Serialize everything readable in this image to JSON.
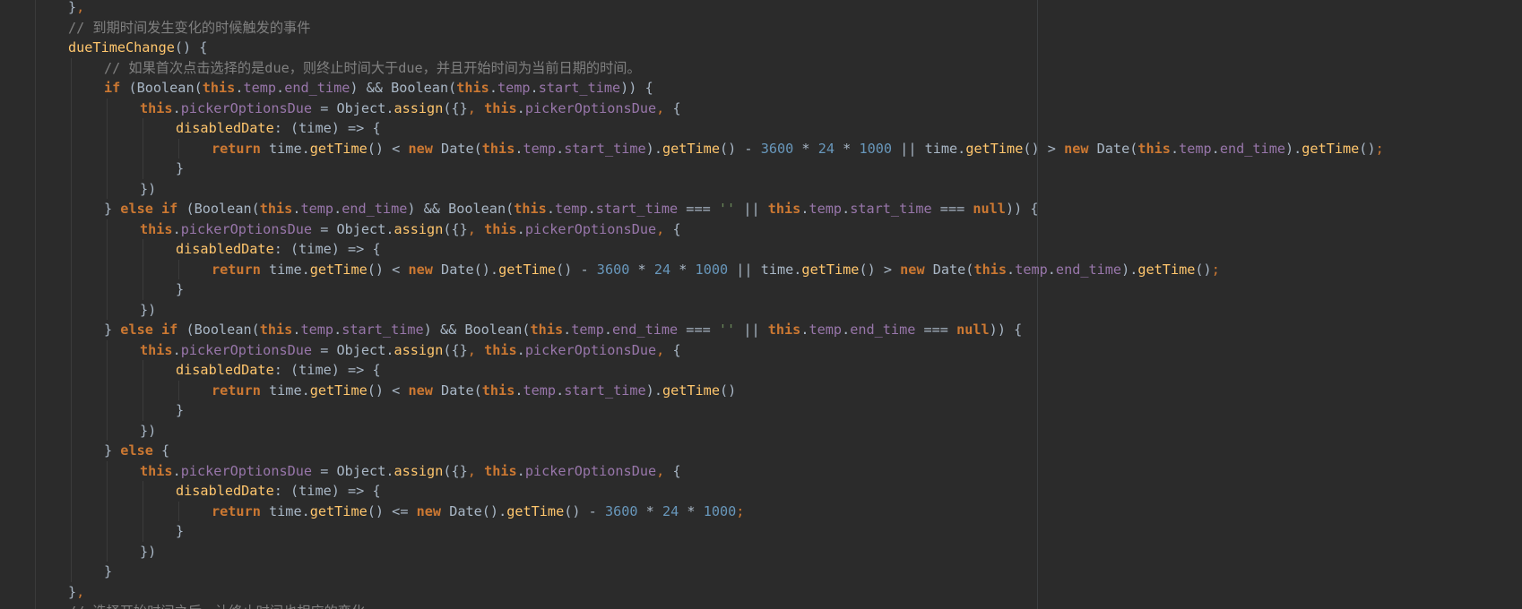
{
  "colors": {
    "background": "#2b2b2b",
    "text": "#a9b7c6",
    "keyword": "#cc7832",
    "field": "#9876aa",
    "method": "#ffc66d",
    "number": "#6897bb",
    "string": "#6a8759",
    "comment": "#808080"
  },
  "code_lines": [
    {
      "indent": 1,
      "tokens": [
        [
          "plain",
          "}"
        ],
        [
          "punct",
          ","
        ]
      ]
    },
    {
      "indent": 1,
      "tokens": [
        [
          "comment",
          "// 到期时间发生变化的时候触发的事件"
        ]
      ]
    },
    {
      "indent": 1,
      "tokens": [
        [
          "method",
          "dueTimeChange"
        ],
        [
          "plain",
          "() {"
        ]
      ]
    },
    {
      "indent": 2,
      "tokens": [
        [
          "comment",
          "// 如果首次点击选择的是due，则终止时间大于due，并且开始时间为当前日期的时间。"
        ]
      ]
    },
    {
      "indent": 2,
      "tokens": [
        [
          "keyword",
          "if"
        ],
        [
          "plain",
          " (Boolean("
        ],
        [
          "keyword",
          "this"
        ],
        [
          "plain",
          "."
        ],
        [
          "field",
          "temp"
        ],
        [
          "plain",
          "."
        ],
        [
          "field",
          "end_time"
        ],
        [
          "plain",
          ") && Boolean("
        ],
        [
          "keyword",
          "this"
        ],
        [
          "plain",
          "."
        ],
        [
          "field",
          "temp"
        ],
        [
          "plain",
          "."
        ],
        [
          "field",
          "start_time"
        ],
        [
          "plain",
          ")) {"
        ]
      ]
    },
    {
      "indent": 3,
      "tokens": [
        [
          "keyword",
          "this"
        ],
        [
          "plain",
          "."
        ],
        [
          "field",
          "pickerOptionsDue"
        ],
        [
          "plain",
          " = Object."
        ],
        [
          "method",
          "assign"
        ],
        [
          "plain",
          "({}"
        ],
        [
          "punct",
          ", "
        ],
        [
          "keyword",
          "this"
        ],
        [
          "plain",
          "."
        ],
        [
          "field",
          "pickerOptionsDue"
        ],
        [
          "punct",
          ", "
        ],
        [
          "plain",
          "{"
        ]
      ]
    },
    {
      "indent": 4,
      "tokens": [
        [
          "method",
          "disabledDate"
        ],
        [
          "plain",
          ": (time) => {"
        ]
      ]
    },
    {
      "indent": 5,
      "tokens": [
        [
          "keyword",
          "return "
        ],
        [
          "plain",
          "time."
        ],
        [
          "method",
          "getTime"
        ],
        [
          "plain",
          "() < "
        ],
        [
          "keyword",
          "new "
        ],
        [
          "plain",
          "Date("
        ],
        [
          "keyword",
          "this"
        ],
        [
          "plain",
          "."
        ],
        [
          "field",
          "temp"
        ],
        [
          "plain",
          "."
        ],
        [
          "field",
          "start_time"
        ],
        [
          "plain",
          ")."
        ],
        [
          "method",
          "getTime"
        ],
        [
          "plain",
          "() - "
        ],
        [
          "number",
          "3600"
        ],
        [
          "plain",
          " * "
        ],
        [
          "number",
          "24"
        ],
        [
          "plain",
          " * "
        ],
        [
          "number",
          "1000"
        ],
        [
          "plain",
          " || time."
        ],
        [
          "method",
          "getTime"
        ],
        [
          "plain",
          "() > "
        ],
        [
          "keyword",
          "new "
        ],
        [
          "plain",
          "Date("
        ],
        [
          "keyword",
          "this"
        ],
        [
          "plain",
          "."
        ],
        [
          "field",
          "temp"
        ],
        [
          "plain",
          "."
        ],
        [
          "field",
          "end_time"
        ],
        [
          "plain",
          ")."
        ],
        [
          "method",
          "getTime"
        ],
        [
          "plain",
          "()"
        ],
        [
          "punct",
          ";"
        ]
      ]
    },
    {
      "indent": 4,
      "tokens": [
        [
          "plain",
          "}"
        ]
      ]
    },
    {
      "indent": 3,
      "tokens": [
        [
          "plain",
          "})"
        ]
      ]
    },
    {
      "indent": 2,
      "tokens": [
        [
          "plain",
          "} "
        ],
        [
          "keyword",
          "else if"
        ],
        [
          "plain",
          " (Boolean("
        ],
        [
          "keyword",
          "this"
        ],
        [
          "plain",
          "."
        ],
        [
          "field",
          "temp"
        ],
        [
          "plain",
          "."
        ],
        [
          "field",
          "end_time"
        ],
        [
          "plain",
          ") && Boolean("
        ],
        [
          "keyword",
          "this"
        ],
        [
          "plain",
          "."
        ],
        [
          "field",
          "temp"
        ],
        [
          "plain",
          "."
        ],
        [
          "field",
          "start_time"
        ],
        [
          "plain",
          " === "
        ],
        [
          "string",
          "''"
        ],
        [
          "plain",
          " || "
        ],
        [
          "keyword",
          "this"
        ],
        [
          "plain",
          "."
        ],
        [
          "field",
          "temp"
        ],
        [
          "plain",
          "."
        ],
        [
          "field",
          "start_time"
        ],
        [
          "plain",
          " === "
        ],
        [
          "keyword",
          "null"
        ],
        [
          "plain",
          ")) {"
        ]
      ]
    },
    {
      "indent": 3,
      "tokens": [
        [
          "keyword",
          "this"
        ],
        [
          "plain",
          "."
        ],
        [
          "field",
          "pickerOptionsDue"
        ],
        [
          "plain",
          " = Object."
        ],
        [
          "method",
          "assign"
        ],
        [
          "plain",
          "({}"
        ],
        [
          "punct",
          ", "
        ],
        [
          "keyword",
          "this"
        ],
        [
          "plain",
          "."
        ],
        [
          "field",
          "pickerOptionsDue"
        ],
        [
          "punct",
          ", "
        ],
        [
          "plain",
          "{"
        ]
      ]
    },
    {
      "indent": 4,
      "tokens": [
        [
          "method",
          "disabledDate"
        ],
        [
          "plain",
          ": (time) => {"
        ]
      ]
    },
    {
      "indent": 5,
      "tokens": [
        [
          "keyword",
          "return "
        ],
        [
          "plain",
          "time."
        ],
        [
          "method",
          "getTime"
        ],
        [
          "plain",
          "() < "
        ],
        [
          "keyword",
          "new "
        ],
        [
          "plain",
          "Date()."
        ],
        [
          "method",
          "getTime"
        ],
        [
          "plain",
          "() - "
        ],
        [
          "number",
          "3600"
        ],
        [
          "plain",
          " * "
        ],
        [
          "number",
          "24"
        ],
        [
          "plain",
          " * "
        ],
        [
          "number",
          "1000"
        ],
        [
          "plain",
          " || time."
        ],
        [
          "method",
          "getTime"
        ],
        [
          "plain",
          "() > "
        ],
        [
          "keyword",
          "new "
        ],
        [
          "plain",
          "Date("
        ],
        [
          "keyword",
          "this"
        ],
        [
          "plain",
          "."
        ],
        [
          "field",
          "temp"
        ],
        [
          "plain",
          "."
        ],
        [
          "field",
          "end_time"
        ],
        [
          "plain",
          ")."
        ],
        [
          "method",
          "getTime"
        ],
        [
          "plain",
          "()"
        ],
        [
          "punct",
          ";"
        ]
      ]
    },
    {
      "indent": 4,
      "tokens": [
        [
          "plain",
          "}"
        ]
      ]
    },
    {
      "indent": 3,
      "tokens": [
        [
          "plain",
          "})"
        ]
      ]
    },
    {
      "indent": 2,
      "tokens": [
        [
          "plain",
          "} "
        ],
        [
          "keyword",
          "else if"
        ],
        [
          "plain",
          " (Boolean("
        ],
        [
          "keyword",
          "this"
        ],
        [
          "plain",
          "."
        ],
        [
          "field",
          "temp"
        ],
        [
          "plain",
          "."
        ],
        [
          "field",
          "start_time"
        ],
        [
          "plain",
          ") && Boolean("
        ],
        [
          "keyword",
          "this"
        ],
        [
          "plain",
          "."
        ],
        [
          "field",
          "temp"
        ],
        [
          "plain",
          "."
        ],
        [
          "field",
          "end_time"
        ],
        [
          "plain",
          " === "
        ],
        [
          "string",
          "''"
        ],
        [
          "plain",
          " || "
        ],
        [
          "keyword",
          "this"
        ],
        [
          "plain",
          "."
        ],
        [
          "field",
          "temp"
        ],
        [
          "plain",
          "."
        ],
        [
          "field",
          "end_time"
        ],
        [
          "plain",
          " === "
        ],
        [
          "keyword",
          "null"
        ],
        [
          "plain",
          ")) {"
        ]
      ]
    },
    {
      "indent": 3,
      "tokens": [
        [
          "keyword",
          "this"
        ],
        [
          "plain",
          "."
        ],
        [
          "field",
          "pickerOptionsDue"
        ],
        [
          "plain",
          " = Object."
        ],
        [
          "method",
          "assign"
        ],
        [
          "plain",
          "({}"
        ],
        [
          "punct",
          ", "
        ],
        [
          "keyword",
          "this"
        ],
        [
          "plain",
          "."
        ],
        [
          "field",
          "pickerOptionsDue"
        ],
        [
          "punct",
          ", "
        ],
        [
          "plain",
          "{"
        ]
      ]
    },
    {
      "indent": 4,
      "tokens": [
        [
          "method",
          "disabledDate"
        ],
        [
          "plain",
          ": (time) => {"
        ]
      ]
    },
    {
      "indent": 5,
      "tokens": [
        [
          "keyword",
          "return "
        ],
        [
          "plain",
          "time."
        ],
        [
          "method",
          "getTime"
        ],
        [
          "plain",
          "() < "
        ],
        [
          "keyword",
          "new "
        ],
        [
          "plain",
          "Date("
        ],
        [
          "keyword",
          "this"
        ],
        [
          "plain",
          "."
        ],
        [
          "field",
          "temp"
        ],
        [
          "plain",
          "."
        ],
        [
          "field",
          "start_time"
        ],
        [
          "plain",
          ")."
        ],
        [
          "method",
          "getTime"
        ],
        [
          "plain",
          "()"
        ]
      ]
    },
    {
      "indent": 4,
      "tokens": [
        [
          "plain",
          "}"
        ]
      ]
    },
    {
      "indent": 3,
      "tokens": [
        [
          "plain",
          "})"
        ]
      ]
    },
    {
      "indent": 2,
      "tokens": [
        [
          "plain",
          "} "
        ],
        [
          "keyword",
          "else"
        ],
        [
          "plain",
          " {"
        ]
      ]
    },
    {
      "indent": 3,
      "tokens": [
        [
          "keyword",
          "this"
        ],
        [
          "plain",
          "."
        ],
        [
          "field",
          "pickerOptionsDue"
        ],
        [
          "plain",
          " = Object."
        ],
        [
          "method",
          "assign"
        ],
        [
          "plain",
          "({}"
        ],
        [
          "punct",
          ", "
        ],
        [
          "keyword",
          "this"
        ],
        [
          "plain",
          "."
        ],
        [
          "field",
          "pickerOptionsDue"
        ],
        [
          "punct",
          ", "
        ],
        [
          "plain",
          "{"
        ]
      ]
    },
    {
      "indent": 4,
      "tokens": [
        [
          "method",
          "disabledDate"
        ],
        [
          "plain",
          ": (time) => {"
        ]
      ]
    },
    {
      "indent": 5,
      "tokens": [
        [
          "keyword",
          "return "
        ],
        [
          "plain",
          "time."
        ],
        [
          "method",
          "getTime"
        ],
        [
          "plain",
          "() <= "
        ],
        [
          "keyword",
          "new "
        ],
        [
          "plain",
          "Date()."
        ],
        [
          "method",
          "getTime"
        ],
        [
          "plain",
          "() - "
        ],
        [
          "number",
          "3600"
        ],
        [
          "plain",
          " * "
        ],
        [
          "number",
          "24"
        ],
        [
          "plain",
          " * "
        ],
        [
          "number",
          "1000"
        ],
        [
          "punct",
          ";"
        ]
      ]
    },
    {
      "indent": 4,
      "tokens": [
        [
          "plain",
          "}"
        ]
      ]
    },
    {
      "indent": 3,
      "tokens": [
        [
          "plain",
          "})"
        ]
      ]
    },
    {
      "indent": 2,
      "tokens": [
        [
          "plain",
          "}"
        ]
      ]
    },
    {
      "indent": 1,
      "tokens": [
        [
          "plain",
          "}"
        ],
        [
          "punct",
          ","
        ]
      ]
    },
    {
      "indent": 1,
      "tokens": [
        [
          "comment",
          "// 选择开始时间之后，让终止时间也相应的变化"
        ]
      ]
    }
  ]
}
